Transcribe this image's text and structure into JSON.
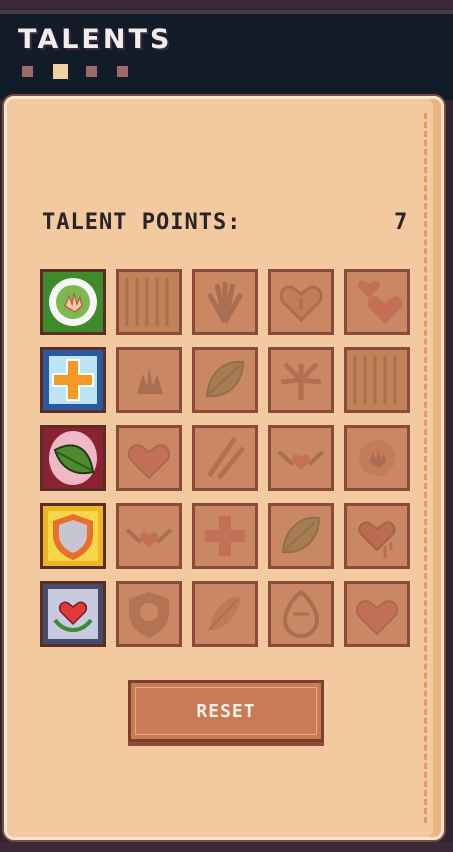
{
  "header": {
    "title": "TALENTS",
    "page_dots": 4,
    "active_dot": 1
  },
  "talents": {
    "points_label": "TALENT POINTS:",
    "points_value": "7",
    "reset_label": "RESET",
    "colors": {
      "panel": "#f3c9a0",
      "locked_tile": "#c98764",
      "header_bg": "#121c28"
    },
    "rows": [
      [
        {
          "icon": "hand-ring-icon",
          "unlocked": true
        },
        {
          "icon": "wood-texture-icon",
          "unlocked": false
        },
        {
          "icon": "hand-fan-icon",
          "unlocked": false
        },
        {
          "icon": "heart-spiral-icon",
          "unlocked": false
        },
        {
          "icon": "double-heart-icon",
          "unlocked": false
        }
      ],
      [
        {
          "icon": "medical-cross-icon",
          "unlocked": true
        },
        {
          "icon": "hand-flame-icon",
          "unlocked": false
        },
        {
          "icon": "leaf-icon",
          "unlocked": false
        },
        {
          "icon": "hand-burst-icon",
          "unlocked": false
        },
        {
          "icon": "wood-texture-icon",
          "unlocked": false
        }
      ],
      [
        {
          "icon": "leaf-aura-icon",
          "unlocked": true
        },
        {
          "icon": "heart-icon",
          "unlocked": false
        },
        {
          "icon": "claw-icon",
          "unlocked": false
        },
        {
          "icon": "winged-heart-icon",
          "unlocked": false
        },
        {
          "icon": "hand-heal-icon",
          "unlocked": false
        }
      ],
      [
        {
          "icon": "shield-icon",
          "unlocked": true
        },
        {
          "icon": "winged-heart-icon",
          "unlocked": false
        },
        {
          "icon": "cross-icon",
          "unlocked": false
        },
        {
          "icon": "leaf-icon",
          "unlocked": false
        },
        {
          "icon": "dripping-heart-icon",
          "unlocked": false
        }
      ],
      [
        {
          "icon": "laurel-heart-icon",
          "unlocked": true
        },
        {
          "icon": "skull-shield-icon",
          "unlocked": false
        },
        {
          "icon": "feather-icon",
          "unlocked": false
        },
        {
          "icon": "totem-icon",
          "unlocked": false
        },
        {
          "icon": "heart-icon",
          "unlocked": false
        }
      ]
    ]
  }
}
